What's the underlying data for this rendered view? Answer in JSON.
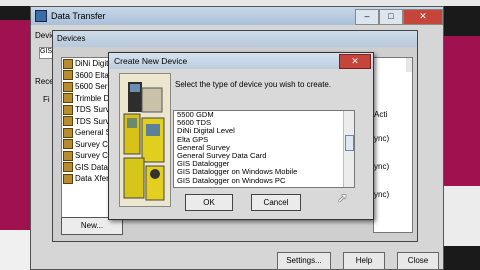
{
  "main_window": {
    "title": "Data Transfer",
    "device_label": "Devic",
    "gis_value": "GIS",
    "received_label": "Rece",
    "files_label": "Fi",
    "controls": {
      "minimize": "–",
      "maximize": "□",
      "close": "✕"
    },
    "bottom_buttons": [
      {
        "label": "Settings..."
      },
      {
        "label": "Help"
      },
      {
        "label": "Close"
      }
    ]
  },
  "devices_window": {
    "title": "Devices",
    "items": [
      {
        "label": "DiNi Digital",
        "icon": "level-icon"
      },
      {
        "label": "3600 Elta",
        "icon": "total-station-icon"
      },
      {
        "label": "5600 Seri",
        "icon": "total-station-icon"
      },
      {
        "label": "Trimble D",
        "icon": "total-station-icon"
      },
      {
        "label": "TDS Surv",
        "icon": "datacollector-icon"
      },
      {
        "label": "TDS Surv",
        "icon": "datacollector-icon"
      },
      {
        "label": "General S",
        "icon": "survey-icon"
      },
      {
        "label": "Survey Ct",
        "icon": "datacollector-icon"
      },
      {
        "label": "Survey C",
        "icon": "datacollector-icon"
      },
      {
        "label": "GIS Datal",
        "icon": "gis-icon"
      },
      {
        "label": "Data Xfer",
        "icon": "transfer-icon"
      }
    ],
    "right_col": [
      "Acti",
      "ync)",
      "ync)",
      "ync)"
    ],
    "new_button": "New..."
  },
  "dialog": {
    "title": "Create New Device",
    "close": "✕",
    "prompt": "Select the type of device you wish to create.",
    "list_items": [
      "5500 GDM",
      "5600 TDS",
      "DiNi Digital Level",
      "Elta GPS",
      "General Survey",
      "General Survey Data Card",
      "GIS Datalogger",
      "GIS Datalogger on Windows Mobile",
      "GIS Datalogger on Windows PC"
    ],
    "ok": "OK",
    "cancel": "Cancel"
  }
}
